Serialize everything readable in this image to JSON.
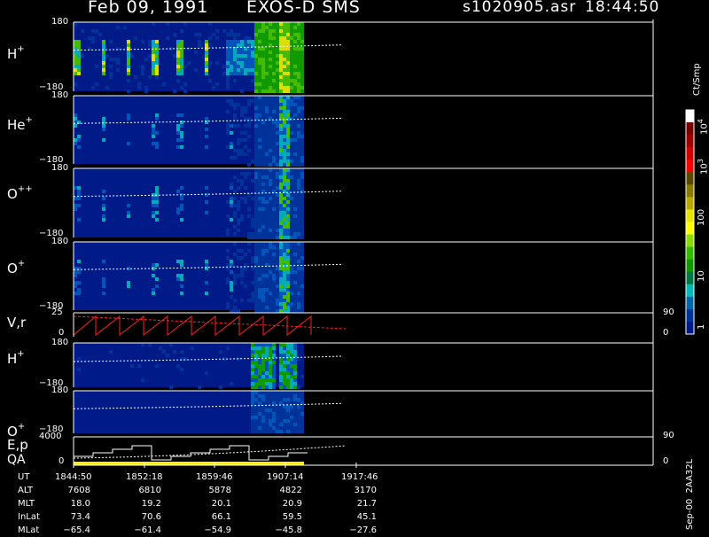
{
  "header": {
    "date": "Feb 09, 1991",
    "instrument": "EXOS-D SMS",
    "file": "s1020905.asr",
    "time": "18:44:50"
  },
  "colorbar": {
    "unit": "Ct/Smp",
    "labels": [
      {
        "text": "10",
        "sup": "4",
        "value": 10000
      },
      {
        "text": "10",
        "sup": "3",
        "value": 1000
      },
      {
        "text": "100",
        "sup": "",
        "value": 100
      },
      {
        "text": "10",
        "sup": "",
        "value": 10
      },
      {
        "text": "1",
        "sup": "",
        "value": 1
      }
    ],
    "colors": [
      "#ffffff",
      "#7a0000",
      "#a00000",
      "#d00000",
      "#ff0000",
      "#5a4a00",
      "#8a7a00",
      "#b8a800",
      "#e6e600",
      "#ffff00",
      "#88dd00",
      "#33bb00",
      "#119900",
      "#007744",
      "#00bbbb",
      "#0066aa",
      "#003399",
      "#001a88"
    ]
  },
  "chart_data": [
    {
      "type": "heatmap",
      "panel": "H+",
      "label": "H",
      "sup": "+",
      "ytick_top": "180",
      "ytick_bottom": "−180",
      "ylim": [
        -180,
        180
      ]
    },
    {
      "type": "heatmap",
      "panel": "He+",
      "label": "He",
      "sup": "+",
      "ytick_top": "180",
      "ytick_bottom": "−180",
      "ylim": [
        -180,
        180
      ]
    },
    {
      "type": "heatmap",
      "panel": "O++",
      "label": "O",
      "sup": "++",
      "ytick_top": "180",
      "ytick_bottom": "−180",
      "ylim": [
        -180,
        180
      ]
    },
    {
      "type": "heatmap",
      "panel": "O+",
      "label": "O",
      "sup": "+",
      "ytick_top": "180",
      "ytick_bottom": "−180",
      "ylim": [
        -180,
        180
      ]
    },
    {
      "type": "line",
      "panel": "V,r",
      "label": "V,r",
      "ytick_top": "25",
      "ytick_bottom": "0",
      "ylim": [
        0,
        25
      ],
      "right_top": "90",
      "right_bottom": "0"
    },
    {
      "type": "heatmap",
      "panel": "H+ (2)",
      "label": "H",
      "sup": "+",
      "ytick_top": "180",
      "ytick_bottom": "−180",
      "ylim": [
        -180,
        180
      ]
    },
    {
      "type": "heatmap",
      "panel": "O+ (2)",
      "label": "O",
      "sup": "+",
      "ytick_top": "180",
      "ytick_bottom": "−180",
      "ylim": [
        -180,
        180
      ]
    },
    {
      "type": "line",
      "panel": "E,p QA",
      "label": "E,p",
      "label2": "QA",
      "ytick_top": "4000",
      "ytick_bottom": "0",
      "ylim": [
        0,
        4000
      ],
      "right_top": "90",
      "right_bottom": "0"
    }
  ],
  "ephemeris": {
    "rows": [
      "UT",
      "ALT",
      "MLT",
      "InLat",
      "MLat"
    ],
    "columns": [
      {
        "UT": "1844:50",
        "ALT": "7608",
        "MLT": "18.0",
        "InLat": "73.4",
        "MLat": "−65.4"
      },
      {
        "UT": "1852:18",
        "ALT": "6810",
        "MLT": "19.2",
        "InLat": "70.6",
        "MLat": "−61.4"
      },
      {
        "UT": "1859:46",
        "ALT": "5878",
        "MLT": "20.1",
        "InLat": "66.1",
        "MLat": "−54.9"
      },
      {
        "UT": "1907:14",
        "ALT": "4822",
        "MLT": "20.9",
        "InLat": "59.5",
        "MLat": "−45.8"
      },
      {
        "UT": "1917:46",
        "ALT": "3170",
        "MLT": "21.7",
        "InLat": "45.1",
        "MLat": "−27.6"
      }
    ]
  },
  "footer": {
    "version": "Sep-00",
    "code": "2AA32L"
  }
}
